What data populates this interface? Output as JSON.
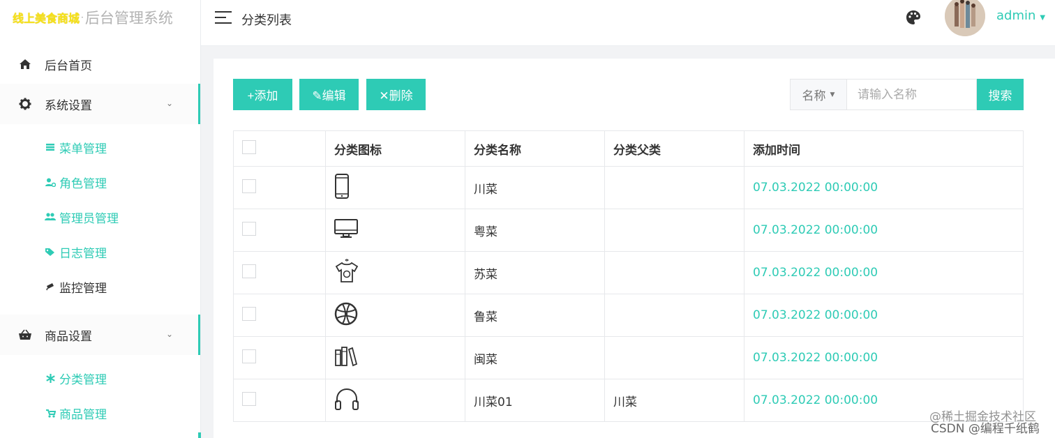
{
  "logo": {
    "brand": "线上美食商城",
    "separator": "·",
    "system": "后台管理系统"
  },
  "sidebar": {
    "home": {
      "label": "后台首页",
      "icon": "home-icon"
    },
    "groups": [
      {
        "label": "系统设置",
        "icon": "gear-icon",
        "items": [
          {
            "label": "菜单管理",
            "icon": "list-icon"
          },
          {
            "label": "角色管理",
            "icon": "user-gear-icon"
          },
          {
            "label": "管理员管理",
            "icon": "users-icon"
          },
          {
            "label": "日志管理",
            "icon": "tags-icon"
          },
          {
            "label": "监控管理",
            "icon": "camera-icon"
          }
        ]
      },
      {
        "label": "商品设置",
        "icon": "basket-icon",
        "items": [
          {
            "label": "分类管理",
            "icon": "asterisk-icon"
          },
          {
            "label": "商品管理",
            "icon": "stroller-icon"
          }
        ]
      }
    ]
  },
  "header": {
    "breadcrumb": "分类列表",
    "user": "admin"
  },
  "toolbar": {
    "add": "+添加",
    "edit": "✎编辑",
    "delete": "✕删除",
    "search_field": "名称",
    "search_placeholder": "请输入名称",
    "search_button": "搜索"
  },
  "table": {
    "headers": [
      "分类图标",
      "分类名称",
      "分类父类",
      "添加时间"
    ],
    "rows": [
      {
        "icon": "phone-icon",
        "name": "川菜",
        "parent": "",
        "time": "07.03.2022 00:00:00"
      },
      {
        "icon": "monitor-icon",
        "name": "粤菜",
        "parent": "",
        "time": "07.03.2022 00:00:00"
      },
      {
        "icon": "shirt-icon",
        "name": "苏菜",
        "parent": "",
        "time": "07.03.2022 00:00:00"
      },
      {
        "icon": "basketball-icon",
        "name": "鲁菜",
        "parent": "",
        "time": "07.03.2022 00:00:00"
      },
      {
        "icon": "books-icon",
        "name": "闽菜",
        "parent": "",
        "time": "07.03.2022 00:00:00"
      },
      {
        "icon": "headphones-icon",
        "name": "川菜01",
        "parent": "川菜",
        "time": "07.03.2022 00:00:00"
      }
    ]
  },
  "watermark": {
    "line1": "@稀土掘金技术社区",
    "line2": "CSDN @编程千纸鹤"
  },
  "colors": {
    "accent": "#2ecbb5",
    "brand_yellow": "#f5e21a"
  }
}
